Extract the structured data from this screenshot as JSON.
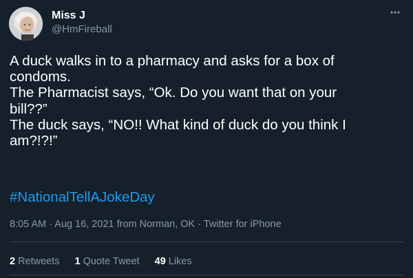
{
  "author": {
    "name": "Miss J",
    "handle": "@HmFireball"
  },
  "more_icon": "more-horizontal-icon",
  "tweet": {
    "text": "A duck walks in to a pharmacy and asks for a box of\ncondoms.\nThe Pharmacist says, “Ok. Do you want that on your\nbill??”\nThe duck says, “NO!! What kind of duck do you think I\nam?!?!”",
    "hashtag": "#NationalTellAJokeDay"
  },
  "meta": {
    "time": "8:05 AM",
    "date": "Aug 16, 2021",
    "location": "from Norman, OK",
    "source": "Twitter for iPhone",
    "separator": " · "
  },
  "stats": {
    "retweets_count": "2",
    "retweets_label": "Retweets",
    "quotes_count": "1",
    "quotes_label": "Quote Tweet",
    "likes_count": "49",
    "likes_label": "Likes"
  },
  "colors": {
    "background": "#15202b",
    "text": "#ffffff",
    "secondary": "#8b98a5",
    "link": "#1d9bf0",
    "divider": "#38444d"
  }
}
